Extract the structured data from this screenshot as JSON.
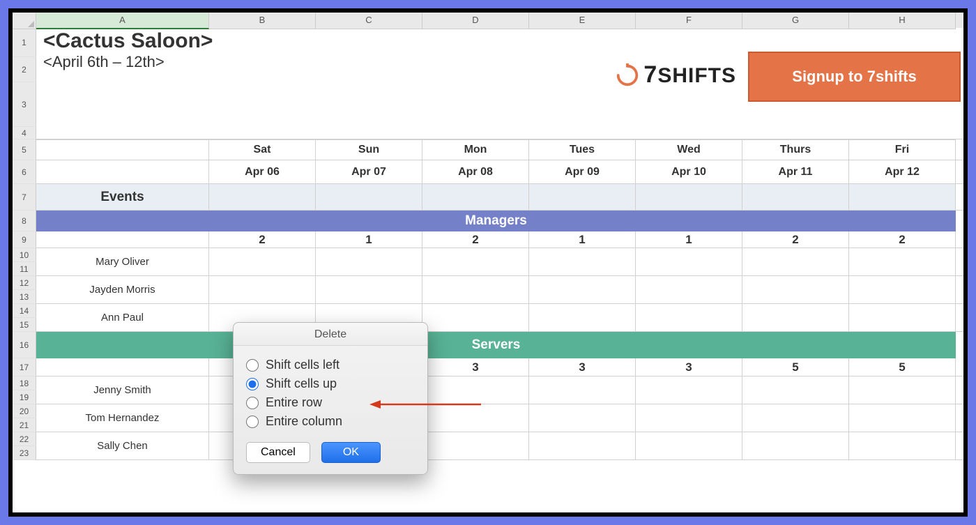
{
  "columns": [
    "A",
    "B",
    "C",
    "D",
    "E",
    "F",
    "G",
    "H"
  ],
  "rows": [
    "1",
    "2",
    "3",
    "4",
    "5",
    "6",
    "7",
    "8",
    "9",
    "10",
    "11",
    "12",
    "13",
    "14",
    "15",
    "16",
    "17",
    "18",
    "19",
    "20",
    "21",
    "22",
    "23"
  ],
  "title": "<Cactus Saloon>",
  "subtitle": "<April 6th – 12th>",
  "brand_text": "SHIFTS",
  "signup_label": "Signup to 7shifts",
  "days": {
    "labels": [
      "Sat",
      "Sun",
      "Mon",
      "Tues",
      "Wed",
      "Thurs",
      "Fri"
    ],
    "dates": [
      "Apr 06",
      "Apr 07",
      "Apr 08",
      "Apr 09",
      "Apr 10",
      "Apr 11",
      "Apr 12"
    ]
  },
  "events_label": "Events",
  "sections": {
    "managers": {
      "title": "Managers",
      "counts": [
        "2",
        "1",
        "2",
        "1",
        "1",
        "2",
        "2"
      ],
      "employees": [
        "Mary Oliver",
        "Jayden Morris",
        "Ann Paul"
      ]
    },
    "servers": {
      "title": "Servers",
      "counts": [
        "",
        "",
        "3",
        "3",
        "3",
        "5",
        "5"
      ],
      "employees": [
        "Jenny Smith",
        "Tom Hernandez",
        "Sally Chen"
      ]
    }
  },
  "dialog": {
    "title": "Delete",
    "options": [
      "Shift cells left",
      "Shift cells up",
      "Entire row",
      "Entire column"
    ],
    "selected_index": 1,
    "cancel": "Cancel",
    "ok": "OK"
  },
  "colors": {
    "frame": "#6a78e8",
    "managers": "#7481c8",
    "servers": "#58b295",
    "signup": "#e57348",
    "arrow": "#d23a1e"
  }
}
